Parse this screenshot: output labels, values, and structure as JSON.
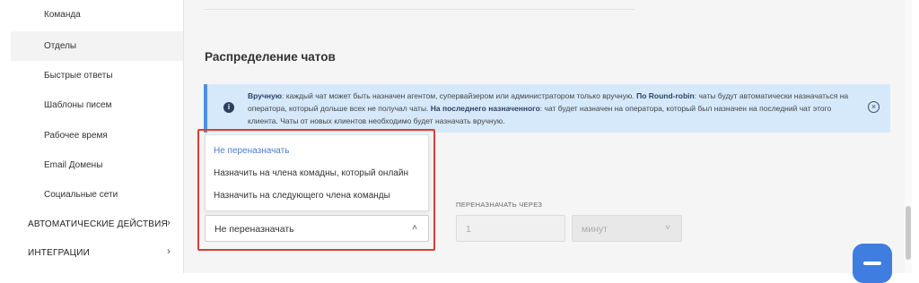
{
  "sidebar": {
    "items": [
      {
        "label": "Команда"
      },
      {
        "label": "Отделы"
      },
      {
        "label": "Быстрые ответы"
      },
      {
        "label": "Шаблоны писем"
      },
      {
        "label": "Рабочее время"
      },
      {
        "label": "Email Домены"
      },
      {
        "label": "Социальные сети"
      }
    ],
    "groups": [
      {
        "label": "АВТОМАТИЧЕСКИЕ ДЕЙСТВИЯ",
        "chevron": "›"
      },
      {
        "label": "ИНТЕГРАЦИИ",
        "chevron": "›"
      }
    ]
  },
  "main": {
    "section_title": "Распределение чатов",
    "info": {
      "icon": "i",
      "bold1": "Вручную",
      "text1": ": каждый чат может быть назначен агентом, супервайзером или администратором только вручную. ",
      "bold2": "По Round-robin",
      "text2": ": чаты будут автоматически назначаться на оператора, который дольше всех не получал чаты. ",
      "bold3": "На последнего назначенного",
      "text3": ": чат будет назначен на оператора, который был назначен на последний чат этого клиента. Чаты от новых клиентов необходимо будет назначать вручную.",
      "close": "×"
    },
    "dropdown": {
      "options": [
        {
          "label": "Не переназначать"
        },
        {
          "label": "Назначить на члена комадны, который онлайн"
        },
        {
          "label": "Назначить на следующего члена команды"
        }
      ],
      "selected_value": "Не переназначать",
      "chevron": "˄"
    },
    "reassign": {
      "label": "ПЕРЕНАЗНАЧАТЬ ЧЕРЕЗ",
      "value": "1",
      "unit": "минут",
      "unit_chevron": "˅"
    }
  },
  "colors": {
    "highlight": "#e03c31",
    "info_bg": "#d5e9fb",
    "accent": "#4a7bd6",
    "chat_button": "#3f7de0"
  }
}
